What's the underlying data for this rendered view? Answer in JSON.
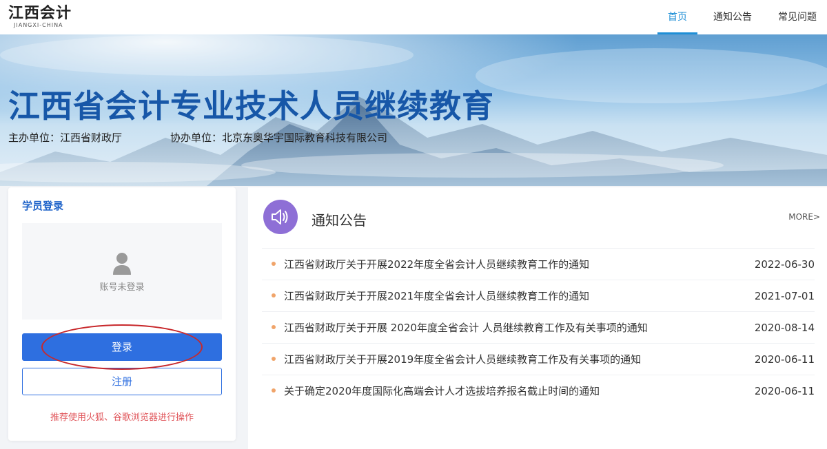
{
  "header": {
    "logo_title": "江西会计",
    "logo_sub": "JIANGXI-CHINA",
    "nav": [
      {
        "label": "首页",
        "active": true
      },
      {
        "label": "通知公告",
        "active": false
      },
      {
        "label": "常见问题",
        "active": false
      }
    ]
  },
  "banner": {
    "title": "江西省会计专业技术人员继续教育",
    "host": "主办单位：江西省财政厅",
    "co_host": "协办单位：北京东奥华宇国际教育科技有限公司"
  },
  "login": {
    "title": "学员登录",
    "status": "账号未登录",
    "login_label": "登录",
    "register_label": "注册",
    "hint": "推荐使用火狐、谷歌浏览器进行操作"
  },
  "notices": {
    "title": "通知公告",
    "more": "MORE>",
    "items": [
      {
        "text": "江西省财政厅关于开展2022年度全省会计人员继续教育工作的通知",
        "date": "2022-06-30"
      },
      {
        "text": "江西省财政厅关于开展2021年度全省会计人员继续教育工作的通知",
        "date": "2021-07-01"
      },
      {
        "text": "江西省财政厅关于开展 2020年度全省会计 人员继续教育工作及有关事项的通知",
        "date": "2020-08-14"
      },
      {
        "text": "江西省财政厅关于开展2019年度全省会计人员继续教育工作及有关事项的通知",
        "date": "2020-06-11"
      },
      {
        "text": "关于确定2020年度国际化高端会计人才选拔培养报名截止时间的通知",
        "date": "2020-06-11"
      }
    ]
  },
  "colors": {
    "primary": "#2e6fe0",
    "nav_active": "#1f8fd6",
    "banner_title": "#1757a8",
    "hint": "#e0555a",
    "notice_icon": "#8e6fd6",
    "bullet": "#f0a46a",
    "annotation": "#c8282b"
  },
  "icons": {
    "user": "user-icon",
    "notice": "speaker-icon"
  }
}
